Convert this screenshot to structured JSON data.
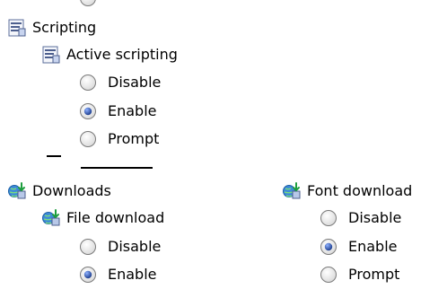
{
  "scripting": {
    "label": "Scripting",
    "icon": "script-settings-icon",
    "active_scripting": {
      "label": "Active scripting",
      "icon": "script-settings-icon",
      "options": [
        {
          "label": "Disable",
          "selected": false
        },
        {
          "label": "Enable",
          "selected": true
        },
        {
          "label": "Prompt",
          "selected": false
        }
      ]
    }
  },
  "downloads": {
    "label": "Downloads",
    "icon": "download-globe-icon",
    "file_download": {
      "label": "File download",
      "icon": "download-globe-icon",
      "options": [
        {
          "label": "Disable",
          "selected": false
        },
        {
          "label": "Enable",
          "selected": true
        }
      ]
    },
    "font_download": {
      "label": "Font download",
      "icon": "download-globe-icon",
      "options": [
        {
          "label": "Disable",
          "selected": false
        },
        {
          "label": "Enable",
          "selected": true
        },
        {
          "label": "Prompt",
          "selected": false
        }
      ]
    }
  },
  "colors": {
    "radio_border": "#7a7a7a",
    "radio_dot": "#1f3f8f"
  }
}
